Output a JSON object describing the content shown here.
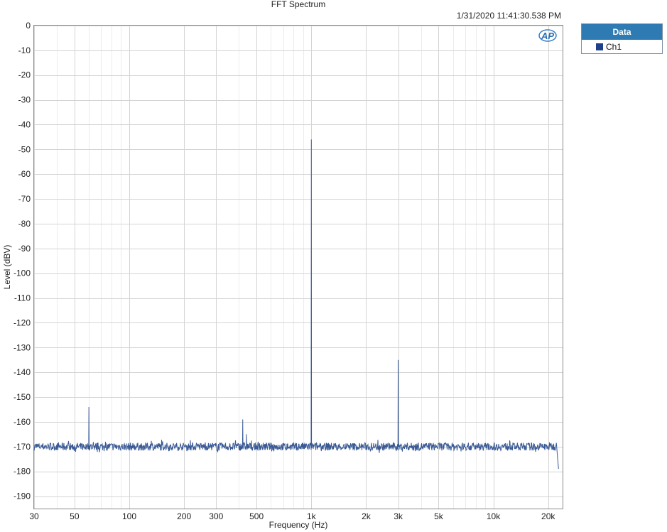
{
  "colors": {
    "trace": "#3a5a95",
    "legend_header": "#2e7ab3",
    "grid": "#d4d4d4",
    "frame": "#8a8a8a"
  },
  "logo": "AP",
  "chart_data": {
    "type": "line",
    "title": "FFT Spectrum",
    "timestamp": "1/31/2020 11:41:30.538 PM",
    "xlabel": "Frequency (Hz)",
    "ylabel": "Level (dBV)",
    "xscale": "log",
    "xlim": [
      30,
      24000
    ],
    "ylim": [
      -195,
      0
    ],
    "x_ticks": [
      30,
      50,
      100,
      200,
      300,
      500,
      1000,
      2000,
      3000,
      5000,
      10000,
      20000
    ],
    "x_tick_labels": [
      "30",
      "50",
      "100",
      "200",
      "300",
      "500",
      "1k",
      "2k",
      "3k",
      "5k",
      "10k",
      "20k"
    ],
    "y_ticks": [
      0,
      -10,
      -20,
      -30,
      -40,
      -50,
      -60,
      -70,
      -80,
      -90,
      -100,
      -110,
      -120,
      -130,
      -140,
      -150,
      -160,
      -170,
      -180,
      -190
    ],
    "grid": true,
    "legend": {
      "title": "Data",
      "position": "right-top",
      "entries": [
        "Ch1"
      ]
    },
    "series": [
      {
        "name": "Ch1",
        "noise_floor_db": -170,
        "end_rolloff": {
          "x": 22800,
          "y": -179
        },
        "peaks": [
          {
            "x": 60,
            "y": -154
          },
          {
            "x": 420,
            "y": -159
          },
          {
            "x": 440,
            "y": -165
          },
          {
            "x": 1000,
            "y": -46
          },
          {
            "x": 3000,
            "y": -135
          }
        ]
      }
    ]
  }
}
